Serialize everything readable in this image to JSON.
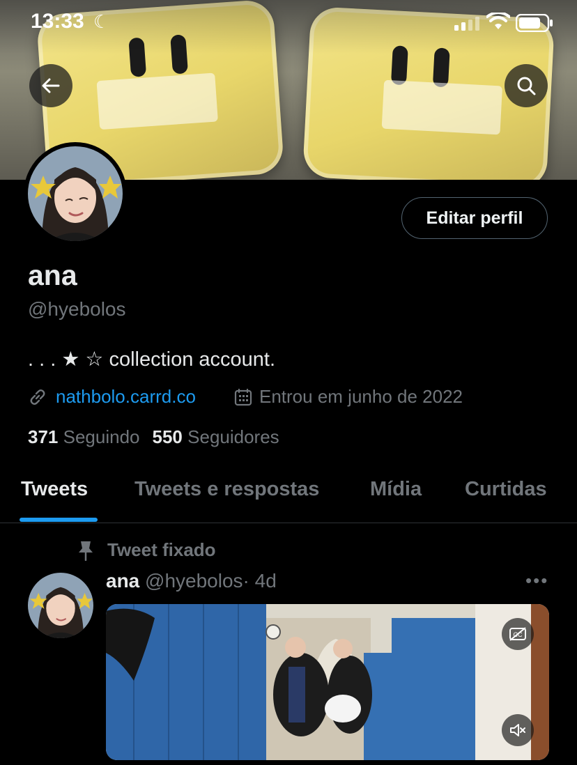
{
  "status_bar": {
    "time": "13:33",
    "moon": "☾"
  },
  "icons": {
    "back": "arrow-left-icon",
    "search": "search-icon",
    "link": "link-icon",
    "calendar": "calendar-icon",
    "pin": "pin-icon",
    "more": "more-horizontal-icon",
    "captions": "captions-off-icon",
    "mute": "volume-muted-icon"
  },
  "colors": {
    "accent": "#1d9bf0",
    "muted": "#71767b",
    "text": "#e7e9ea",
    "background": "#000000"
  },
  "profile": {
    "edit_button": "Editar perfil",
    "display_name": "ana",
    "handle": "@hyebolos",
    "bio": ". . . ★ ☆ collection account.",
    "link": "nathbolo.carrd.co",
    "joined": "Entrou em junho de 2022",
    "following_count": "371",
    "following_label": "Seguindo",
    "followers_count": "550",
    "followers_label": "Seguidores"
  },
  "tabs": [
    {
      "label": "Tweets",
      "active": true
    },
    {
      "label": "Tweets e respostas",
      "active": false
    },
    {
      "label": "Mídia",
      "active": false
    },
    {
      "label": "Curtidas",
      "active": false
    }
  ],
  "pinned_tweet": {
    "pinned_label": "Tweet fixado",
    "author_name": "ana",
    "author_handle": "@hyebolos",
    "time": "· 4d",
    "more": "•••"
  }
}
